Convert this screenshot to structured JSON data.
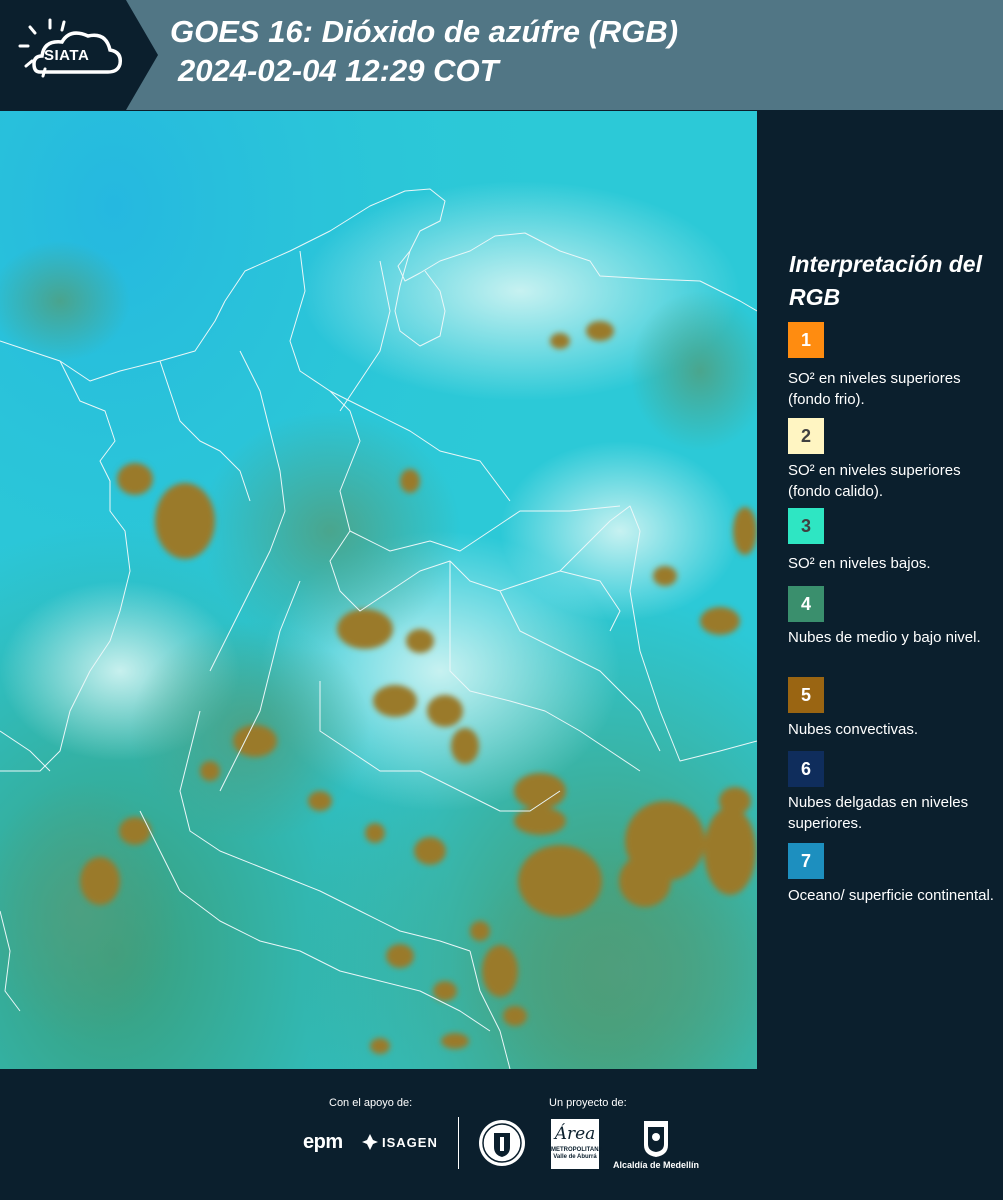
{
  "header": {
    "logo_text": "SIATA",
    "title_line1": "GOES 16: Dióxido de azúfre (RGB)",
    "title_line2": "2024-02-04 12:29 COT"
  },
  "legend": {
    "title": "Interpretación del RGB",
    "items": [
      {
        "num": "1",
        "color": "#ff8c10",
        "text": "SO² en niveles superiores (fondo frio)."
      },
      {
        "num": "2",
        "color": "#fff5c2",
        "text": "SO² en niveles superiores (fondo calido)."
      },
      {
        "num": "3",
        "color": "#2ee6c3",
        "text": "SO² en niveles bajos."
      },
      {
        "num": "4",
        "color": "#3a8f6d",
        "text": "Nubes de medio y bajo nivel."
      },
      {
        "num": "5",
        "color": "#9a6512",
        "text": "Nubes convectivas."
      },
      {
        "num": "6",
        "color": "#0f2d5c",
        "text": "Nubes delgadas en niveles superiores."
      },
      {
        "num": "7",
        "color": "#1d8fbf",
        "text": "Oceano/ superficie continental."
      }
    ]
  },
  "footer": {
    "support_label": "Con el apoyo de:",
    "project_label": "Un proyecto de:",
    "sponsors": [
      "epm",
      "ISAGEN"
    ],
    "area_script": "Área",
    "area_text": "METROPOLITANA Valle de Aburrá",
    "alcaldia_text": "Alcaldía de Medellín"
  },
  "colors": {
    "header_bg": "#517685",
    "page_bg": "#0b1f2d",
    "map_bg": "#29c9d6",
    "cloud_convective": "#9a7a2a",
    "cloud_mid": "#4f9a78"
  }
}
